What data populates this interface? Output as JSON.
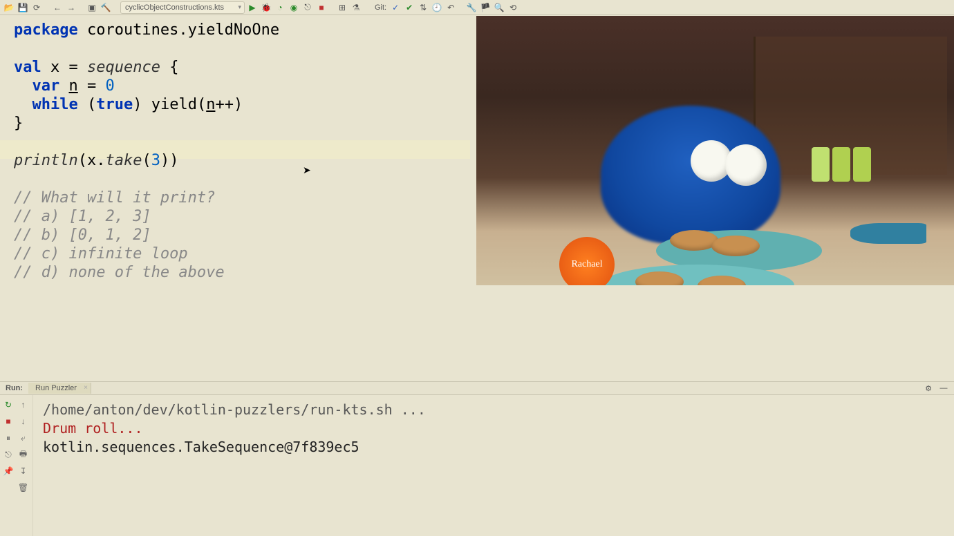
{
  "toolbar": {
    "file_selector": "cyclicObjectConstructions.kts",
    "git_label": "Git:"
  },
  "code": {
    "package_kw": "package",
    "package_name": " coroutines.yieldNoOne",
    "val_kw": "val",
    "x_decl": " x = ",
    "sequence_fn": "sequence",
    "brace_open": " {",
    "var_kw": "var",
    "n_decl": " ",
    "n_var": "n",
    "eq_zero": " = ",
    "zero": "0",
    "while_kw": "while",
    "while_cond_open": " (",
    "true_kw": "true",
    "while_cond_close": ") ",
    "yield_fn": "yield",
    "yield_arg_open": "(",
    "n_var2": "n",
    "inc_close": "++)",
    "brace_close": "}",
    "println_fn": "println",
    "println_arg_open": "(x.",
    "take_fn": "take",
    "take_arg_open": "(",
    "three": "3",
    "take_close": "))",
    "c1": "// What will it print?",
    "c2": "// a) [1, 2, 3]",
    "c3": "// b) [0, 1, 2]",
    "c4": "// c) infinite loop",
    "c5": "// d) none of the above"
  },
  "overlay": {
    "logo_text": "Rachael"
  },
  "run": {
    "panel_label": "Run:",
    "tab_name": "Run Puzzler",
    "output_cmd": "/home/anton/dev/kotlin-puzzlers/run-kts.sh ...",
    "output_drum": "Drum roll...",
    "output_result": "kotlin.sequences.TakeSequence@7f839ec5"
  }
}
